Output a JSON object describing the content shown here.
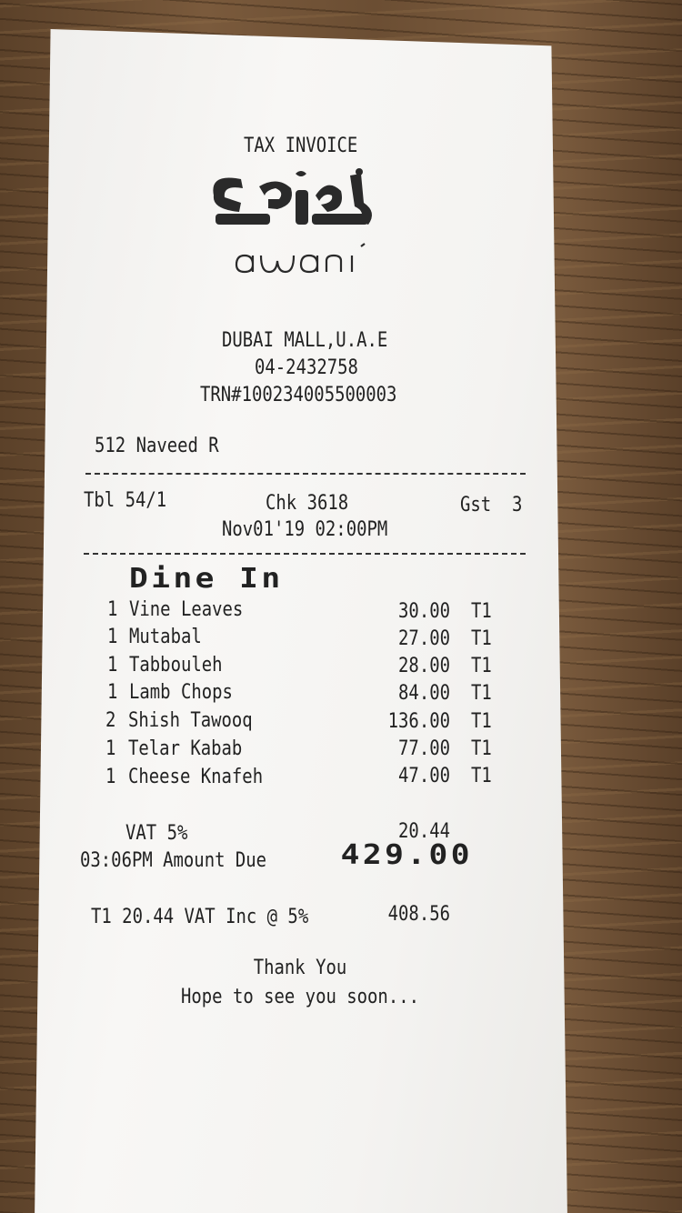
{
  "receipt": {
    "header": "TAX INVOICE",
    "logo_arabic": "أواني",
    "logo_latin": "awani",
    "location": "DUBAI MALL,U.A.E",
    "phone": "04-2432758",
    "trn": "TRN#100234005500003",
    "server": "512 Naveed R",
    "table": "Tbl 54/1",
    "check": "Chk 3618",
    "guests": "Gst  3",
    "datetime": "Nov01'19 02:00PM",
    "order_type": "Dine In",
    "items": [
      {
        "qty": "1",
        "name": "Vine Leaves",
        "price": "30.00",
        "tax": "T1"
      },
      {
        "qty": "1",
        "name": "Mutabal",
        "price": "27.00",
        "tax": "T1"
      },
      {
        "qty": "1",
        "name": "Tabbouleh",
        "price": "28.00",
        "tax": "T1"
      },
      {
        "qty": "1",
        "name": "Lamb Chops",
        "price": "84.00",
        "tax": "T1"
      },
      {
        "qty": "2",
        "name": "Shish Tawooq",
        "price": "136.00",
        "tax": "T1"
      },
      {
        "qty": "1",
        "name": "Telar Kabab",
        "price": "77.00",
        "tax": "T1"
      },
      {
        "qty": "1",
        "name": "Cheese Knafeh",
        "price": "47.00",
        "tax": "T1"
      }
    ],
    "vat_label": "VAT 5%",
    "vat_value": "20.44",
    "due_label": "03:06PM Amount Due",
    "due_value": "429.00",
    "vat_inc_label": "T1 20.44 VAT Inc @ 5%",
    "vat_inc_value": "408.56",
    "thanks": "Thank You",
    "farewell": "Hope to see you soon..."
  },
  "colors": {
    "paper": "#f4f3f1",
    "ink": "#222222",
    "table_wood": "#6a4f35"
  }
}
